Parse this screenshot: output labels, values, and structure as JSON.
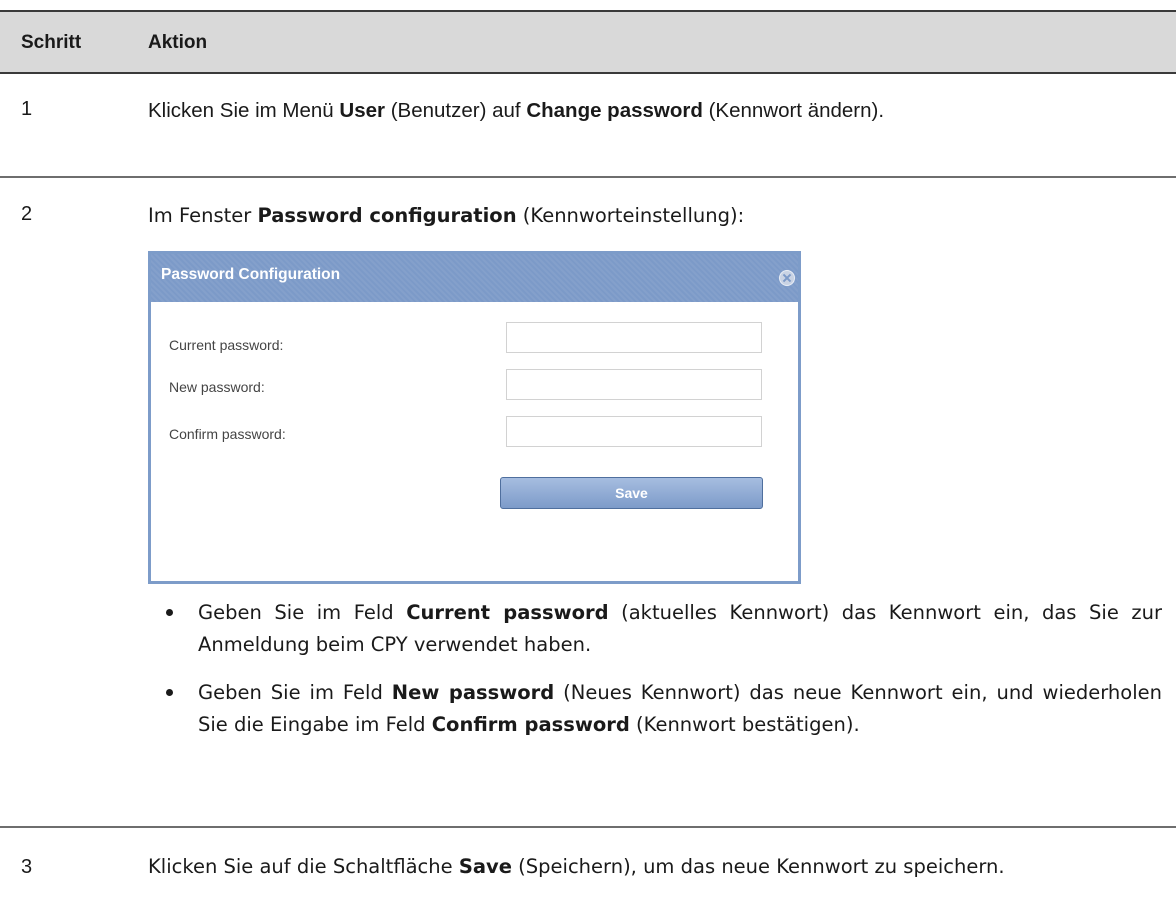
{
  "table": {
    "header": {
      "col_step": "Schritt",
      "col_action": "Aktion"
    }
  },
  "step1": {
    "number": "1",
    "text_a": "Klicken Sie im Menü ",
    "bold_a": "User",
    "text_b": " (Benutzer) auf ",
    "bold_b": "Change password",
    "text_c": " (Kennwort ändern)."
  },
  "step2": {
    "number": "2",
    "text_a": "Im Fenster ",
    "bold_a": "Password configuration",
    "text_b": " (Kennworteinstellung):",
    "dialog": {
      "title": "Password Configuration",
      "fields": [
        {
          "label": "Current password:",
          "value": ""
        },
        {
          "label": "New password:",
          "value": ""
        },
        {
          "label": "Confirm password:",
          "value": ""
        }
      ],
      "save_label": "Save"
    },
    "bullets": [
      {
        "text_a": "Geben Sie im Feld ",
        "bold_a": "Current password",
        "text_b": " (aktuelles Kennwort) das Kennwort ein, das Sie zur Anmeldung beim CPY verwendet haben."
      },
      {
        "text_a": "Geben Sie im Feld ",
        "bold_a": "New password",
        "text_b": " (Neues Kennwort) das neue Kennwort ein, und wiederholen Sie die Eingabe im Feld ",
        "bold_b": "Confirm password",
        "text_c": " (Kennwort bestätigen)."
      }
    ]
  },
  "step3": {
    "number": "3",
    "text_a": "Klicken Sie auf die Schaltfläche ",
    "bold_a": "Save",
    "text_b": " (Speichern), um das neue Kennwort zu speichern."
  }
}
